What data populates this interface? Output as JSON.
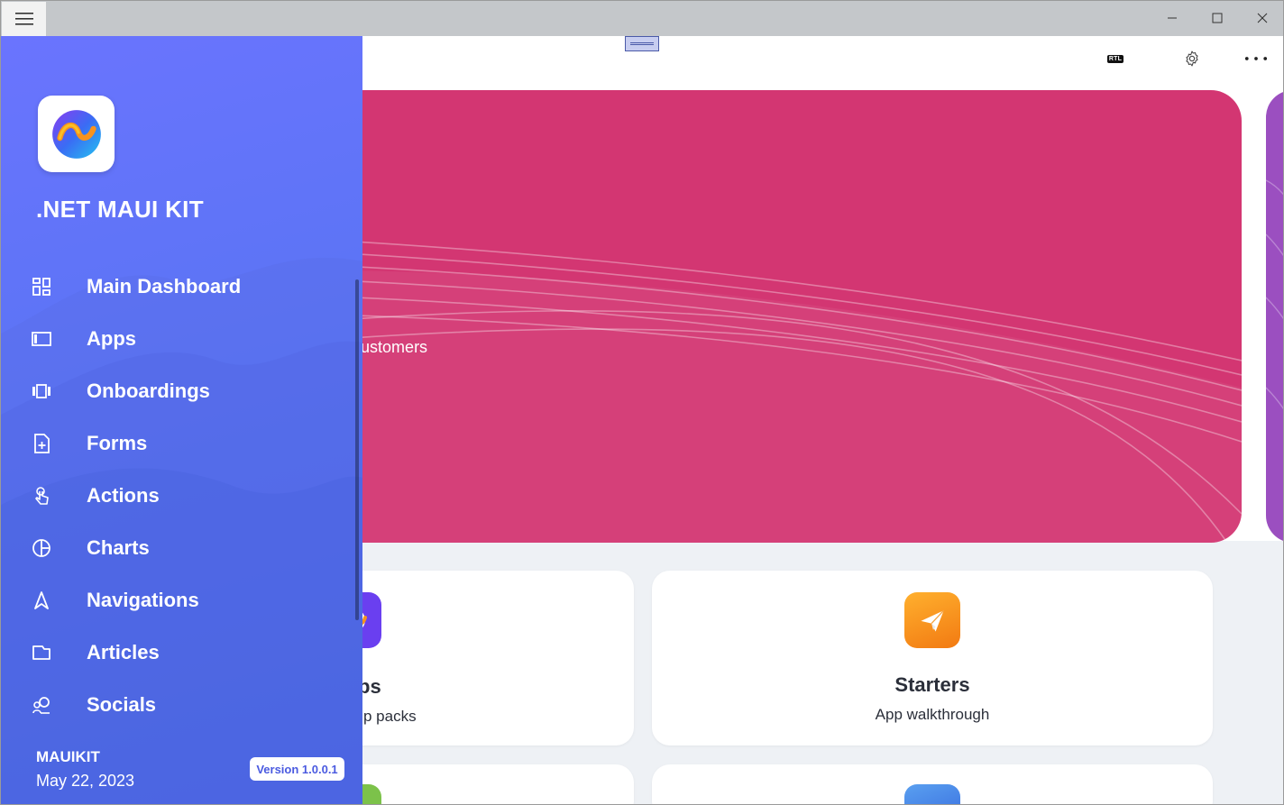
{
  "window": {
    "controls": {
      "minimize_icon": "minimize-icon",
      "maximize_icon": "maximize-icon",
      "close_icon": "close-icon"
    }
  },
  "topbar": {
    "rtl_label": "RTL",
    "settings_icon": "gear-icon",
    "more_icon": "more-icon"
  },
  "hero": {
    "subtitle_fragment": "ce for your customers",
    "color": "#d33672"
  },
  "cards": [
    {
      "title": "ps",
      "subtitle": "p packs",
      "icon": "app-logo-icon"
    },
    {
      "title": "Starters",
      "subtitle": "App walkthrough",
      "icon": "paper-plane-icon",
      "icon_color": "#f7931e"
    }
  ],
  "flyout": {
    "brand": ".NET MAUI KIT",
    "menu": [
      {
        "label": "Main Dashboard",
        "icon": "dashboard-icon"
      },
      {
        "label": "Apps",
        "icon": "apps-icon"
      },
      {
        "label": "Onboardings",
        "icon": "carousel-icon"
      },
      {
        "label": "Forms",
        "icon": "form-icon"
      },
      {
        "label": "Actions",
        "icon": "touch-icon"
      },
      {
        "label": "Charts",
        "icon": "pie-chart-icon"
      },
      {
        "label": "Navigations",
        "icon": "navigation-icon"
      },
      {
        "label": "Articles",
        "icon": "article-icon"
      },
      {
        "label": "Socials",
        "icon": "social-icon"
      }
    ],
    "footer": {
      "user": "MAUIKIT",
      "date": "May 22, 2023",
      "version": "Version 1.0.0.1"
    },
    "gradient_top": "#6a74fe",
    "gradient_bottom": "#4a6ae8"
  }
}
